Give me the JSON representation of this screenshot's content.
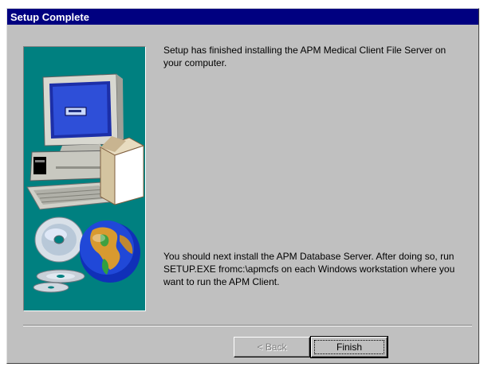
{
  "window": {
    "title": "Setup Complete"
  },
  "messages": {
    "finished": "Setup has finished installing the APM Medical Client File Server on your computer.",
    "next_steps": "You should next install the APM Database Server.  After doing so, run SETUP.EXE fromc:\\apmcfs on each Windows workstation where you want to run the APM Client."
  },
  "buttons": {
    "back_label": "< Back",
    "finish_label": "Finish"
  },
  "colors": {
    "titlebar": "#000080",
    "dialog_face": "#c0c0c0",
    "art_background": "#008080"
  },
  "icons": {
    "artwork": [
      "computer-icon",
      "software-box-icon",
      "cd-disc-icon",
      "globe-icon"
    ]
  }
}
